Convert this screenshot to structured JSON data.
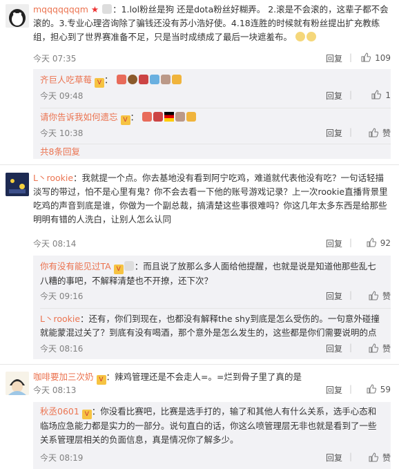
{
  "comments": [
    {
      "user": "mqqqqqqqm",
      "text": "：1.lol粉丝是狗 还是dota粉丝好糊弄。 2.滚是不会滚的，这辈子都不会滚的。3.专业心理咨询除了骗钱还没有苏小浩好使。4.18连胜的时候就有粉丝提出扩充教练组，担心到了世界赛准备不足，只是当时成绩成了最后一块遮羞布。",
      "time": "今天 07:35",
      "reply": "回复",
      "likes": "109",
      "replies": [
        {
          "user": "齐巨人吃草莓",
          "text": "：",
          "time": "今天 09:48",
          "reply": "回复",
          "likes": "1"
        },
        {
          "user": "请你告诉我如何遗忘",
          "text": "：",
          "time": "今天 10:38",
          "reply": "回复",
          "likes": "赞"
        }
      ],
      "more": "共8条回复"
    },
    {
      "user": "L丶rookie",
      "text": "：我就提一个点。你去基地没有看到阿宁吃鸡，难道就代表他没有吃？一句话轻描淡写的带过，怕不是心里有鬼？你不会去看一下他的账号游戏记录？上一次rookie直播背景里吃鸡的声音到底是谁，你做为一个副总裁，搞清楚这些事很难吗？你这几年太多东西是给那些明明有错的人洗白，让别人怎么认同",
      "time": "今天 08:14",
      "reply": "回复",
      "likes": "92",
      "replies": [
        {
          "user": "你有没有能见过TA",
          "text": "：而且说了放那么多人面给他提醒，也就是说是知道他那些乱七八糟的事吧，不解释清楚也不开撩，还下次？",
          "time": "今天 09:16",
          "reply": "回复",
          "likes": "赞"
        },
        {
          "user": "L丶rookie",
          "text": "：还有，你们到现在，也都没有解释the shy到底是怎么受伤的。一句意外碰撞就能蒙混过关了？到底有没有喝酒，那个意外是怎么发生的，这些都是你们需要说明的点",
          "time": "今天 08:16",
          "reply": "回复",
          "likes": "赞"
        }
      ]
    },
    {
      "user": "咖啡要加三次奶",
      "text": "：辣鸡管理还是不会走人=。=烂到骨子里了真的是",
      "time": "今天 08:13",
      "reply": "回复",
      "likes": "59",
      "replies": [
        {
          "user": "秋丞0601",
          "text": "：你没看比赛吧，比赛是选手打的，输了和其他人有什么关系，选手心态和临场应急能力都是实力的一部分。说句直白的话，你这么喷管理层无非也就是看到了一些关系管理层相关的负面信息，真是情况你了解多少。",
          "time": "今天 08:19",
          "reply": "回复",
          "likes": "赞"
        }
      ]
    }
  ],
  "colors": {
    "username": "#eb7350",
    "meta": "#808080",
    "replybg": "#f2f2f5"
  },
  "icons": [
    "thumb-up-icon",
    "emoji-icon",
    "vip-badge-icon"
  ]
}
